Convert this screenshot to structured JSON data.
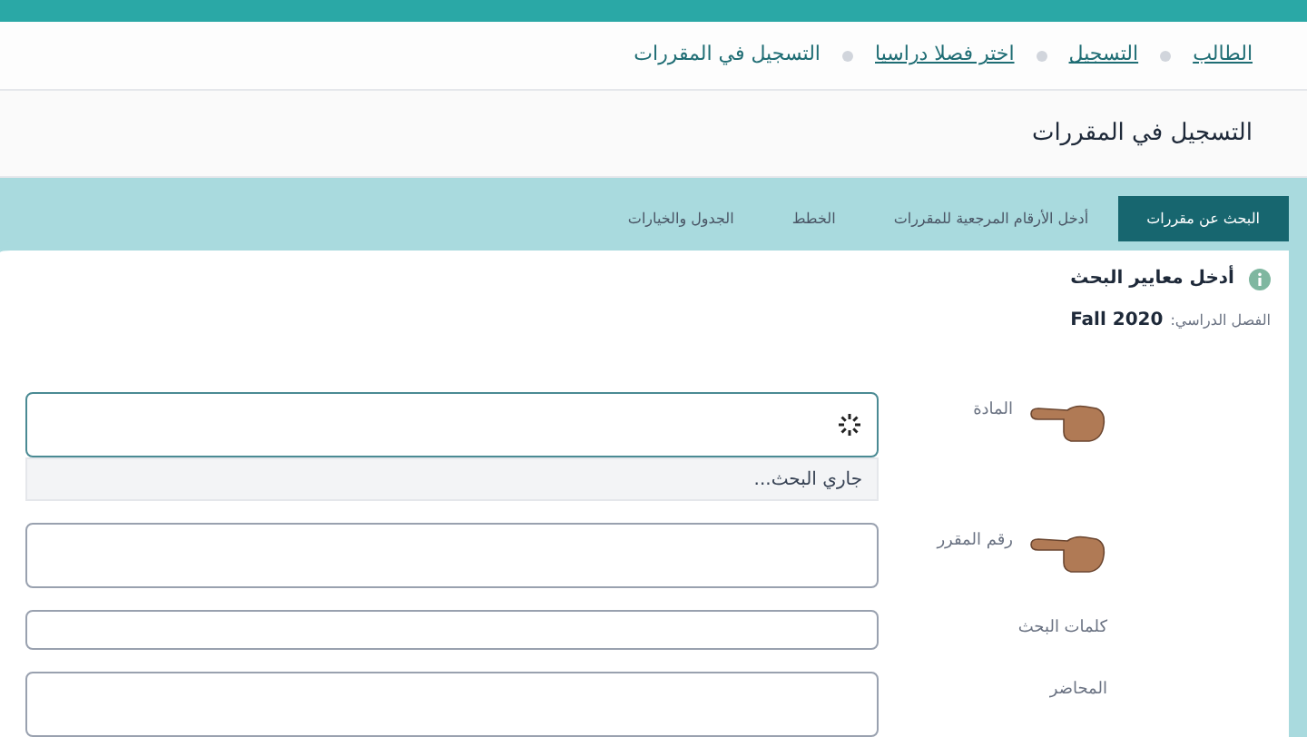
{
  "breadcrumbs": [
    {
      "label": "الطالب",
      "link": true
    },
    {
      "label": "التسجيل",
      "link": true
    },
    {
      "label": "اختر فصلا دراسيا",
      "link": true
    },
    {
      "label": "التسجيل في المقررات",
      "link": false
    }
  ],
  "page_title": "التسجيل في المقررات",
  "tabs": [
    {
      "label": "البحث عن مقررات",
      "selected": true
    },
    {
      "label": "أدخل الأرقام المرجعية للمقررات",
      "selected": false
    },
    {
      "label": "الخطط",
      "selected": false
    },
    {
      "label": "الجدول والخيارات",
      "selected": false
    }
  ],
  "panel": {
    "heading": "أدخل معايير البحث",
    "term_label": "الفصل الدراسي:",
    "term_value": "Fall 2020"
  },
  "fields": [
    {
      "label": "المادة",
      "pointer": true,
      "loading": true,
      "suggestion": "جاري البحث..."
    },
    {
      "label": "رقم المقرر",
      "pointer": true,
      "loading": false
    },
    {
      "label": "كلمات البحث",
      "pointer": false,
      "loading": false
    },
    {
      "label": "المحاضر",
      "pointer": false,
      "loading": false
    }
  ]
}
